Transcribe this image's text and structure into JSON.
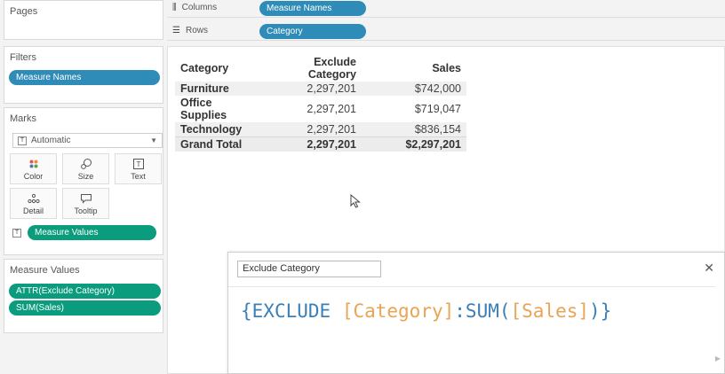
{
  "cards": {
    "pages": {
      "title": "Pages"
    },
    "filters": {
      "title": "Filters",
      "pills": [
        "Measure Names"
      ]
    },
    "marks": {
      "title": "Marks",
      "type_dropdown": "Automatic",
      "buttons": [
        {
          "label": "Color",
          "icon": "color-dots-icon"
        },
        {
          "label": "Size",
          "icon": "size-icon"
        },
        {
          "label": "Text",
          "icon": "text-icon"
        },
        {
          "label": "Detail",
          "icon": "detail-icon"
        },
        {
          "label": "Tooltip",
          "icon": "tooltip-icon"
        }
      ],
      "text_pill": "Measure Values"
    },
    "measure_values": {
      "title": "Measure Values",
      "pills": [
        "ATTR(Exclude Category)",
        "SUM(Sales)"
      ]
    }
  },
  "shelves": {
    "columns": {
      "label": "Columns",
      "pill": "Measure Names"
    },
    "rows": {
      "label": "Rows",
      "pill": "Category"
    }
  },
  "crosstab": {
    "headers": [
      "Category",
      "Exclude Category",
      "Sales"
    ],
    "rows": [
      {
        "category": "Furniture",
        "exclude": "2,297,201",
        "sales": "$742,000"
      },
      {
        "category": "Office Supplies",
        "exclude": "2,297,201",
        "sales": "$719,047"
      },
      {
        "category": "Technology",
        "exclude": "2,297,201",
        "sales": "$836,154"
      }
    ],
    "total": {
      "category": "Grand Total",
      "exclude": "2,297,201",
      "sales": "$2,297,201"
    }
  },
  "calc_editor": {
    "name": "Exclude Category",
    "expression": {
      "open_brace": "{",
      "keyword": "EXCLUDE",
      "dimension": "[Category]",
      "colon": ":",
      "func": "SUM",
      "open_paren": "(",
      "measure": "[Sales]",
      "close_paren": ")",
      "close_brace": "}"
    }
  },
  "colors": {
    "blue_pill": "#2f8cb8",
    "green_pill": "#0b9c7e",
    "calc_keyword": "#3a7fb7",
    "calc_field": "#e9a455"
  }
}
